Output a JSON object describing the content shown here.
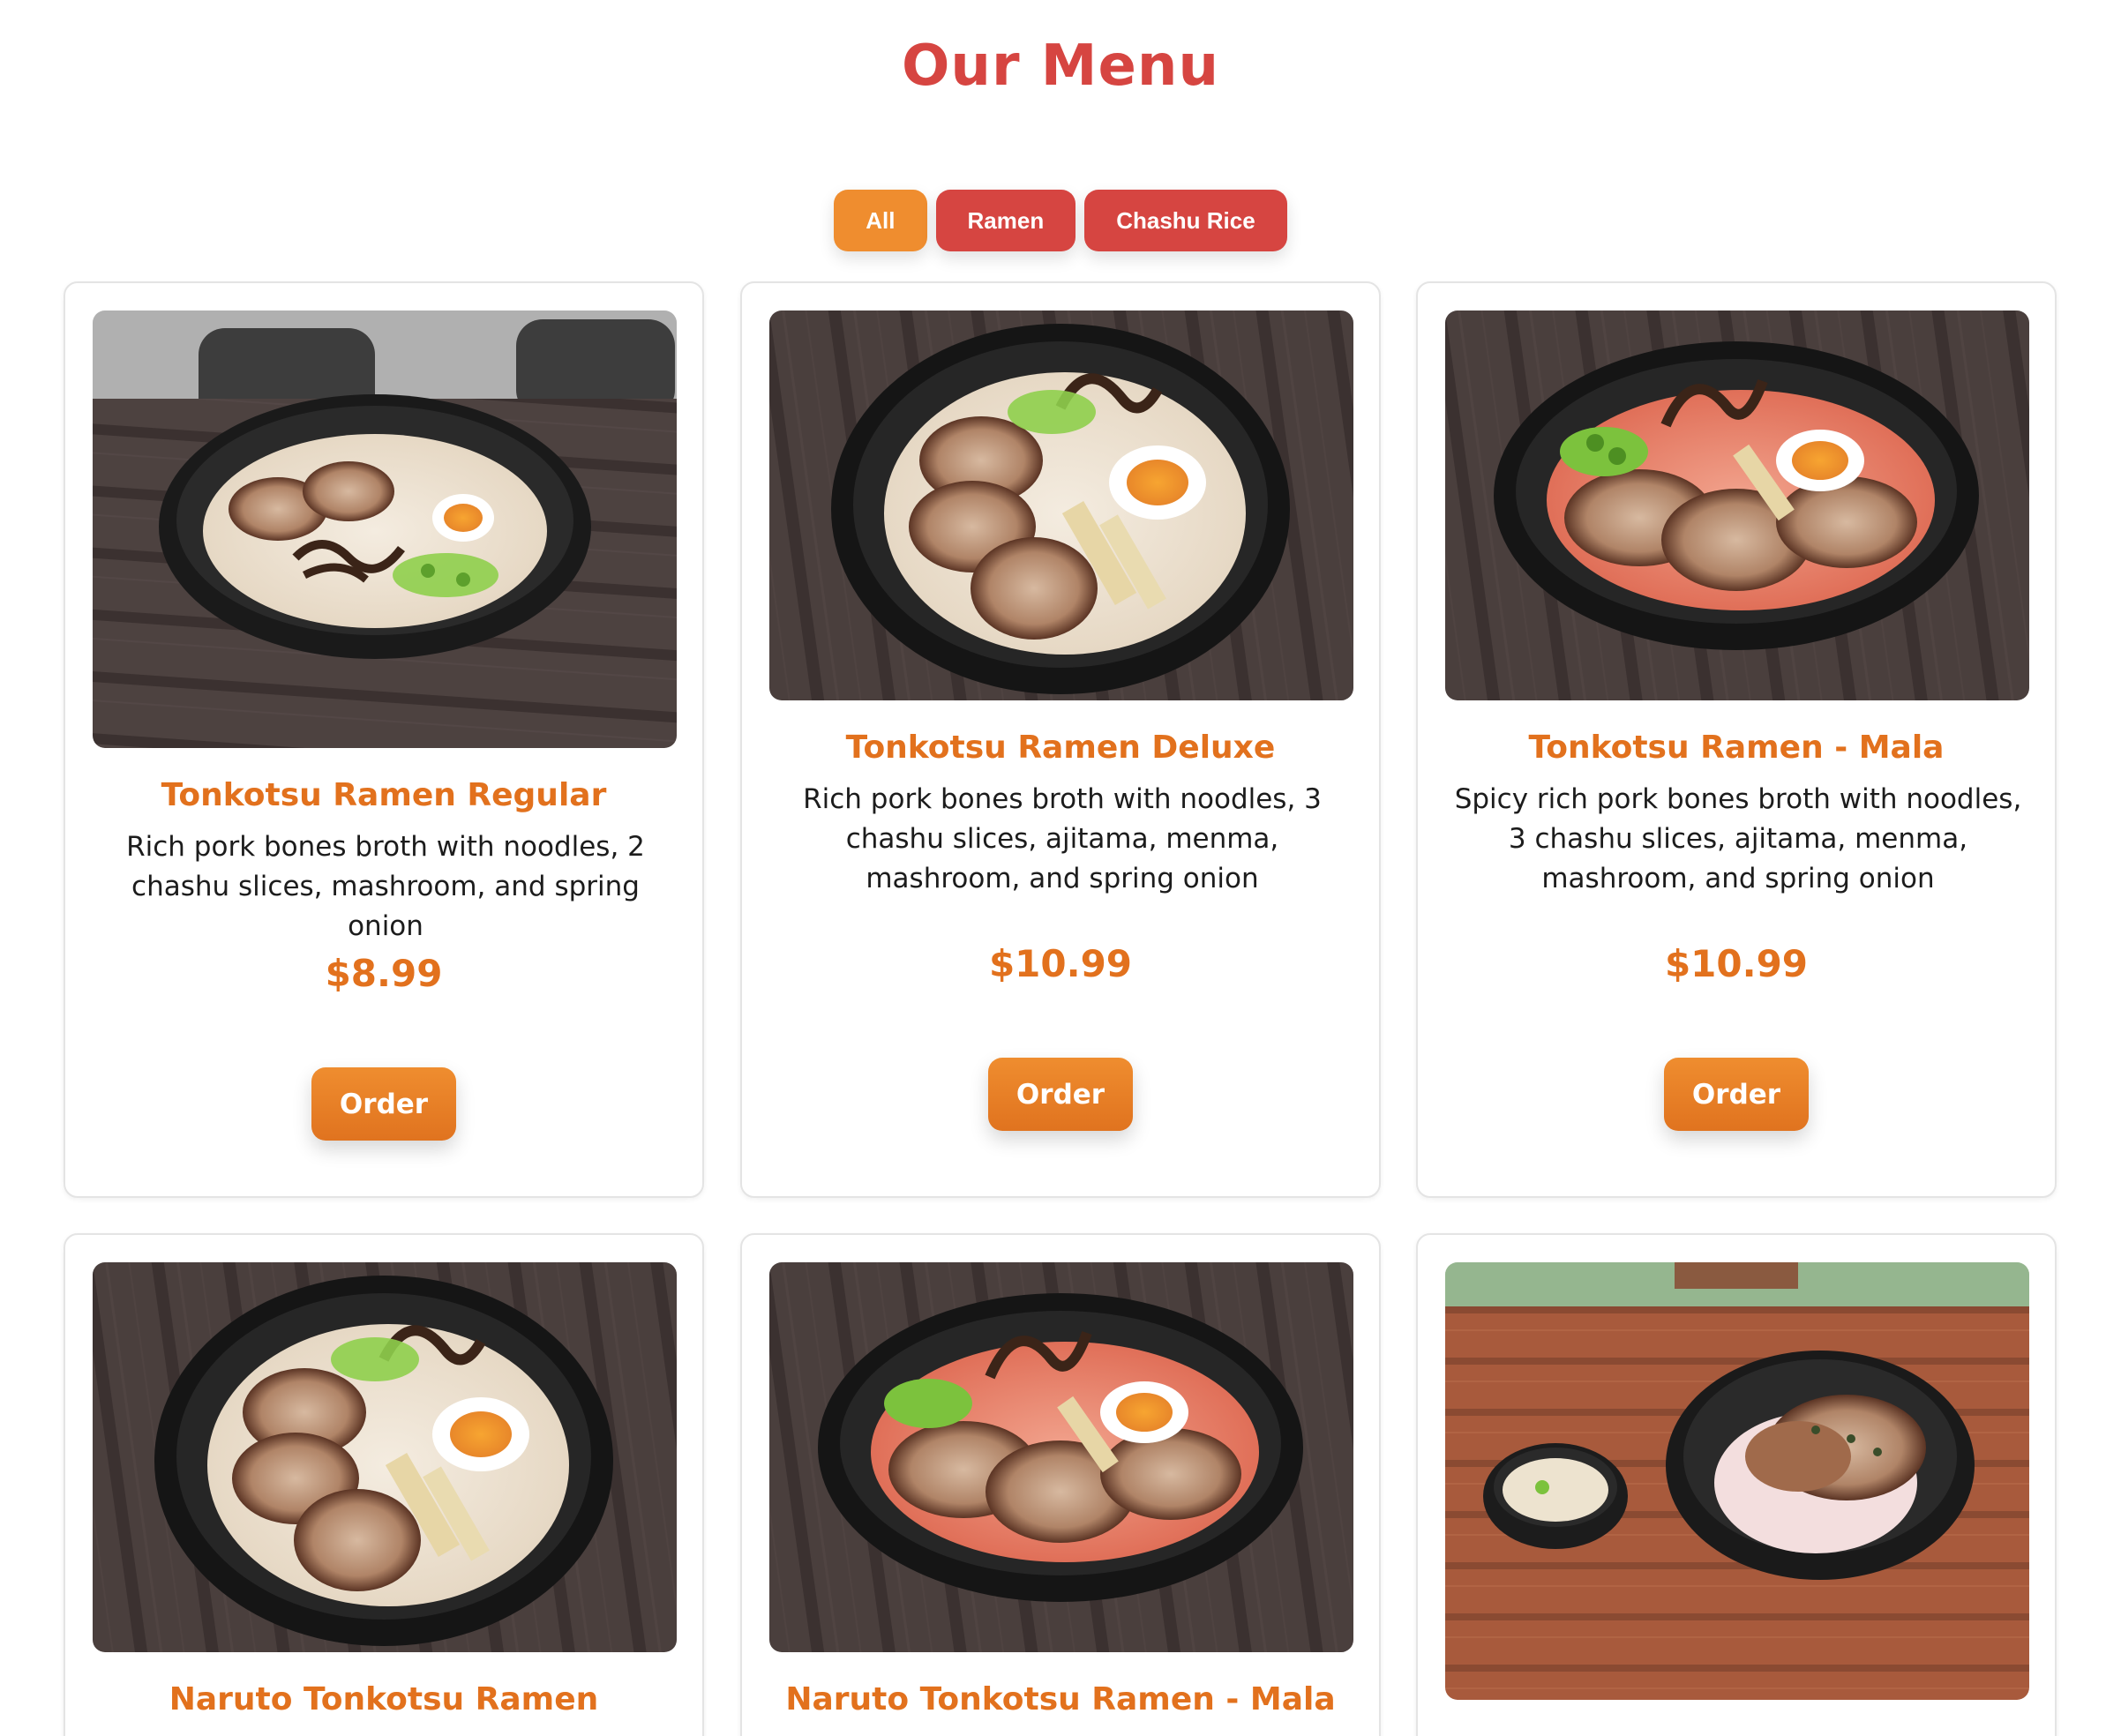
{
  "page": {
    "title": "Our Menu"
  },
  "filters": [
    {
      "label": "All",
      "active": true
    },
    {
      "label": "Ramen",
      "active": false
    },
    {
      "label": "Chashu Rice",
      "active": false
    }
  ],
  "colors": {
    "title": "#d64541",
    "active_filter": "#ef8d2f",
    "inactive_filter": "#d64541",
    "item_name": "#e2711d",
    "order_button": "#ef8d2f"
  },
  "menu_items": [
    {
      "name": "Tonkotsu Ramen Regular",
      "description": "Rich pork bones broth with noodles, 2 chashu slices, mashroom, and spring onion",
      "price": "$8.99",
      "order_label": "Order",
      "photo": "tonkotsu-ramen-regular-photo"
    },
    {
      "name": "Tonkotsu Ramen Deluxe",
      "description": "Rich pork bones broth with noodles, 3 chashu slices, ajitama, menma, mashroom, and spring onion",
      "price": "$10.99",
      "order_label": "Order",
      "photo": "tonkotsu-ramen-deluxe-photo"
    },
    {
      "name": "Tonkotsu Ramen - Mala",
      "description": "Spicy rich pork bones broth with noodles, 3 chashu slices, ajitama, menma, mashroom, and spring onion",
      "price": "$10.99",
      "order_label": "Order",
      "photo": "tonkotsu-ramen-mala-photo"
    },
    {
      "name": "Naruto Tonkotsu Ramen",
      "photo": "naruto-tonkotsu-ramen-photo"
    },
    {
      "name": "Naruto Tonkotsu Ramen - Mala",
      "photo": "naruto-tonkotsu-ramen-mala-photo"
    },
    {
      "name": "",
      "photo": "chashu-rice-bowl-photo"
    }
  ]
}
